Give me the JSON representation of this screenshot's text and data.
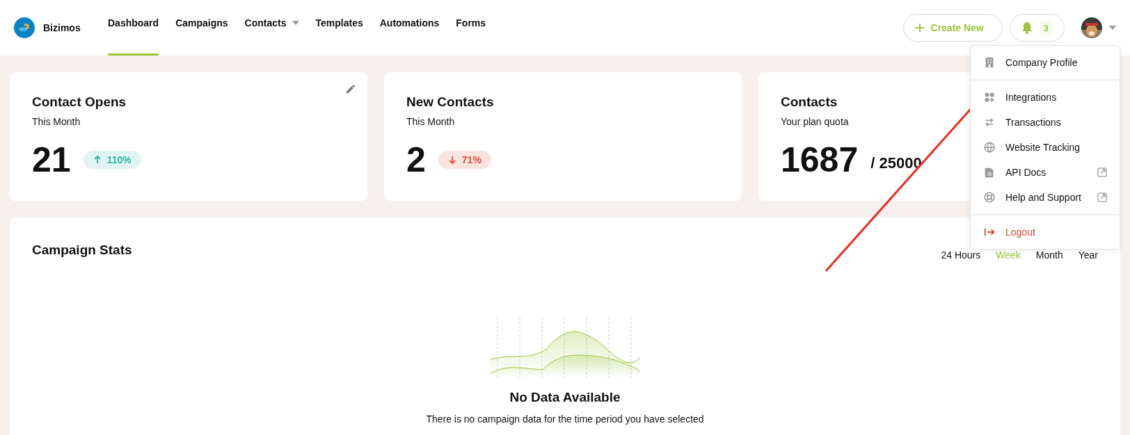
{
  "brand": {
    "name": "Bizimos"
  },
  "nav": [
    {
      "label": "Dashboard",
      "selected": true,
      "dropdown": false
    },
    {
      "label": "Campaigns",
      "selected": false,
      "dropdown": false
    },
    {
      "label": "Contacts",
      "selected": false,
      "dropdown": true
    },
    {
      "label": "Templates",
      "selected": false,
      "dropdown": false
    },
    {
      "label": "Automations",
      "selected": false,
      "dropdown": false
    },
    {
      "label": "Forms",
      "selected": false,
      "dropdown": false
    }
  ],
  "actions": {
    "create_label": "Create New",
    "notification_count": "3"
  },
  "cards": [
    {
      "title": "Contact Opens",
      "subtitle": "This Month",
      "value": "21",
      "change": {
        "label": "110%",
        "up": true
      },
      "editable": true
    },
    {
      "title": "New Contacts",
      "subtitle": "This Month",
      "value": "2",
      "change": {
        "label": "71%",
        "up": false
      },
      "editable": false
    },
    {
      "title": "Contacts",
      "subtitle": "Your plan quota",
      "value": "1687",
      "quota": "/ 25000",
      "editable": false
    }
  ],
  "campaign_stats": {
    "title": "Campaign Stats",
    "ranges": [
      {
        "label": "24 Hours",
        "selected": false
      },
      {
        "label": "Week",
        "selected": true
      },
      {
        "label": "Month",
        "selected": false
      },
      {
        "label": "Year",
        "selected": false
      }
    ],
    "empty_title": "No Data Available",
    "empty_text": "There is no campaign data for the time period you have selected"
  },
  "user_menu": {
    "sections": [
      [
        {
          "label": "Company Profile",
          "kind": "internal"
        }
      ],
      [
        {
          "label": "Integrations",
          "kind": "internal"
        },
        {
          "label": "Transactions",
          "kind": "internal"
        },
        {
          "label": "Website Tracking",
          "kind": "internal"
        },
        {
          "label": "API Docs",
          "kind": "external"
        },
        {
          "label": "Help and Support",
          "kind": "external"
        }
      ],
      [
        {
          "label": "Logout",
          "kind": "danger"
        }
      ]
    ]
  }
}
